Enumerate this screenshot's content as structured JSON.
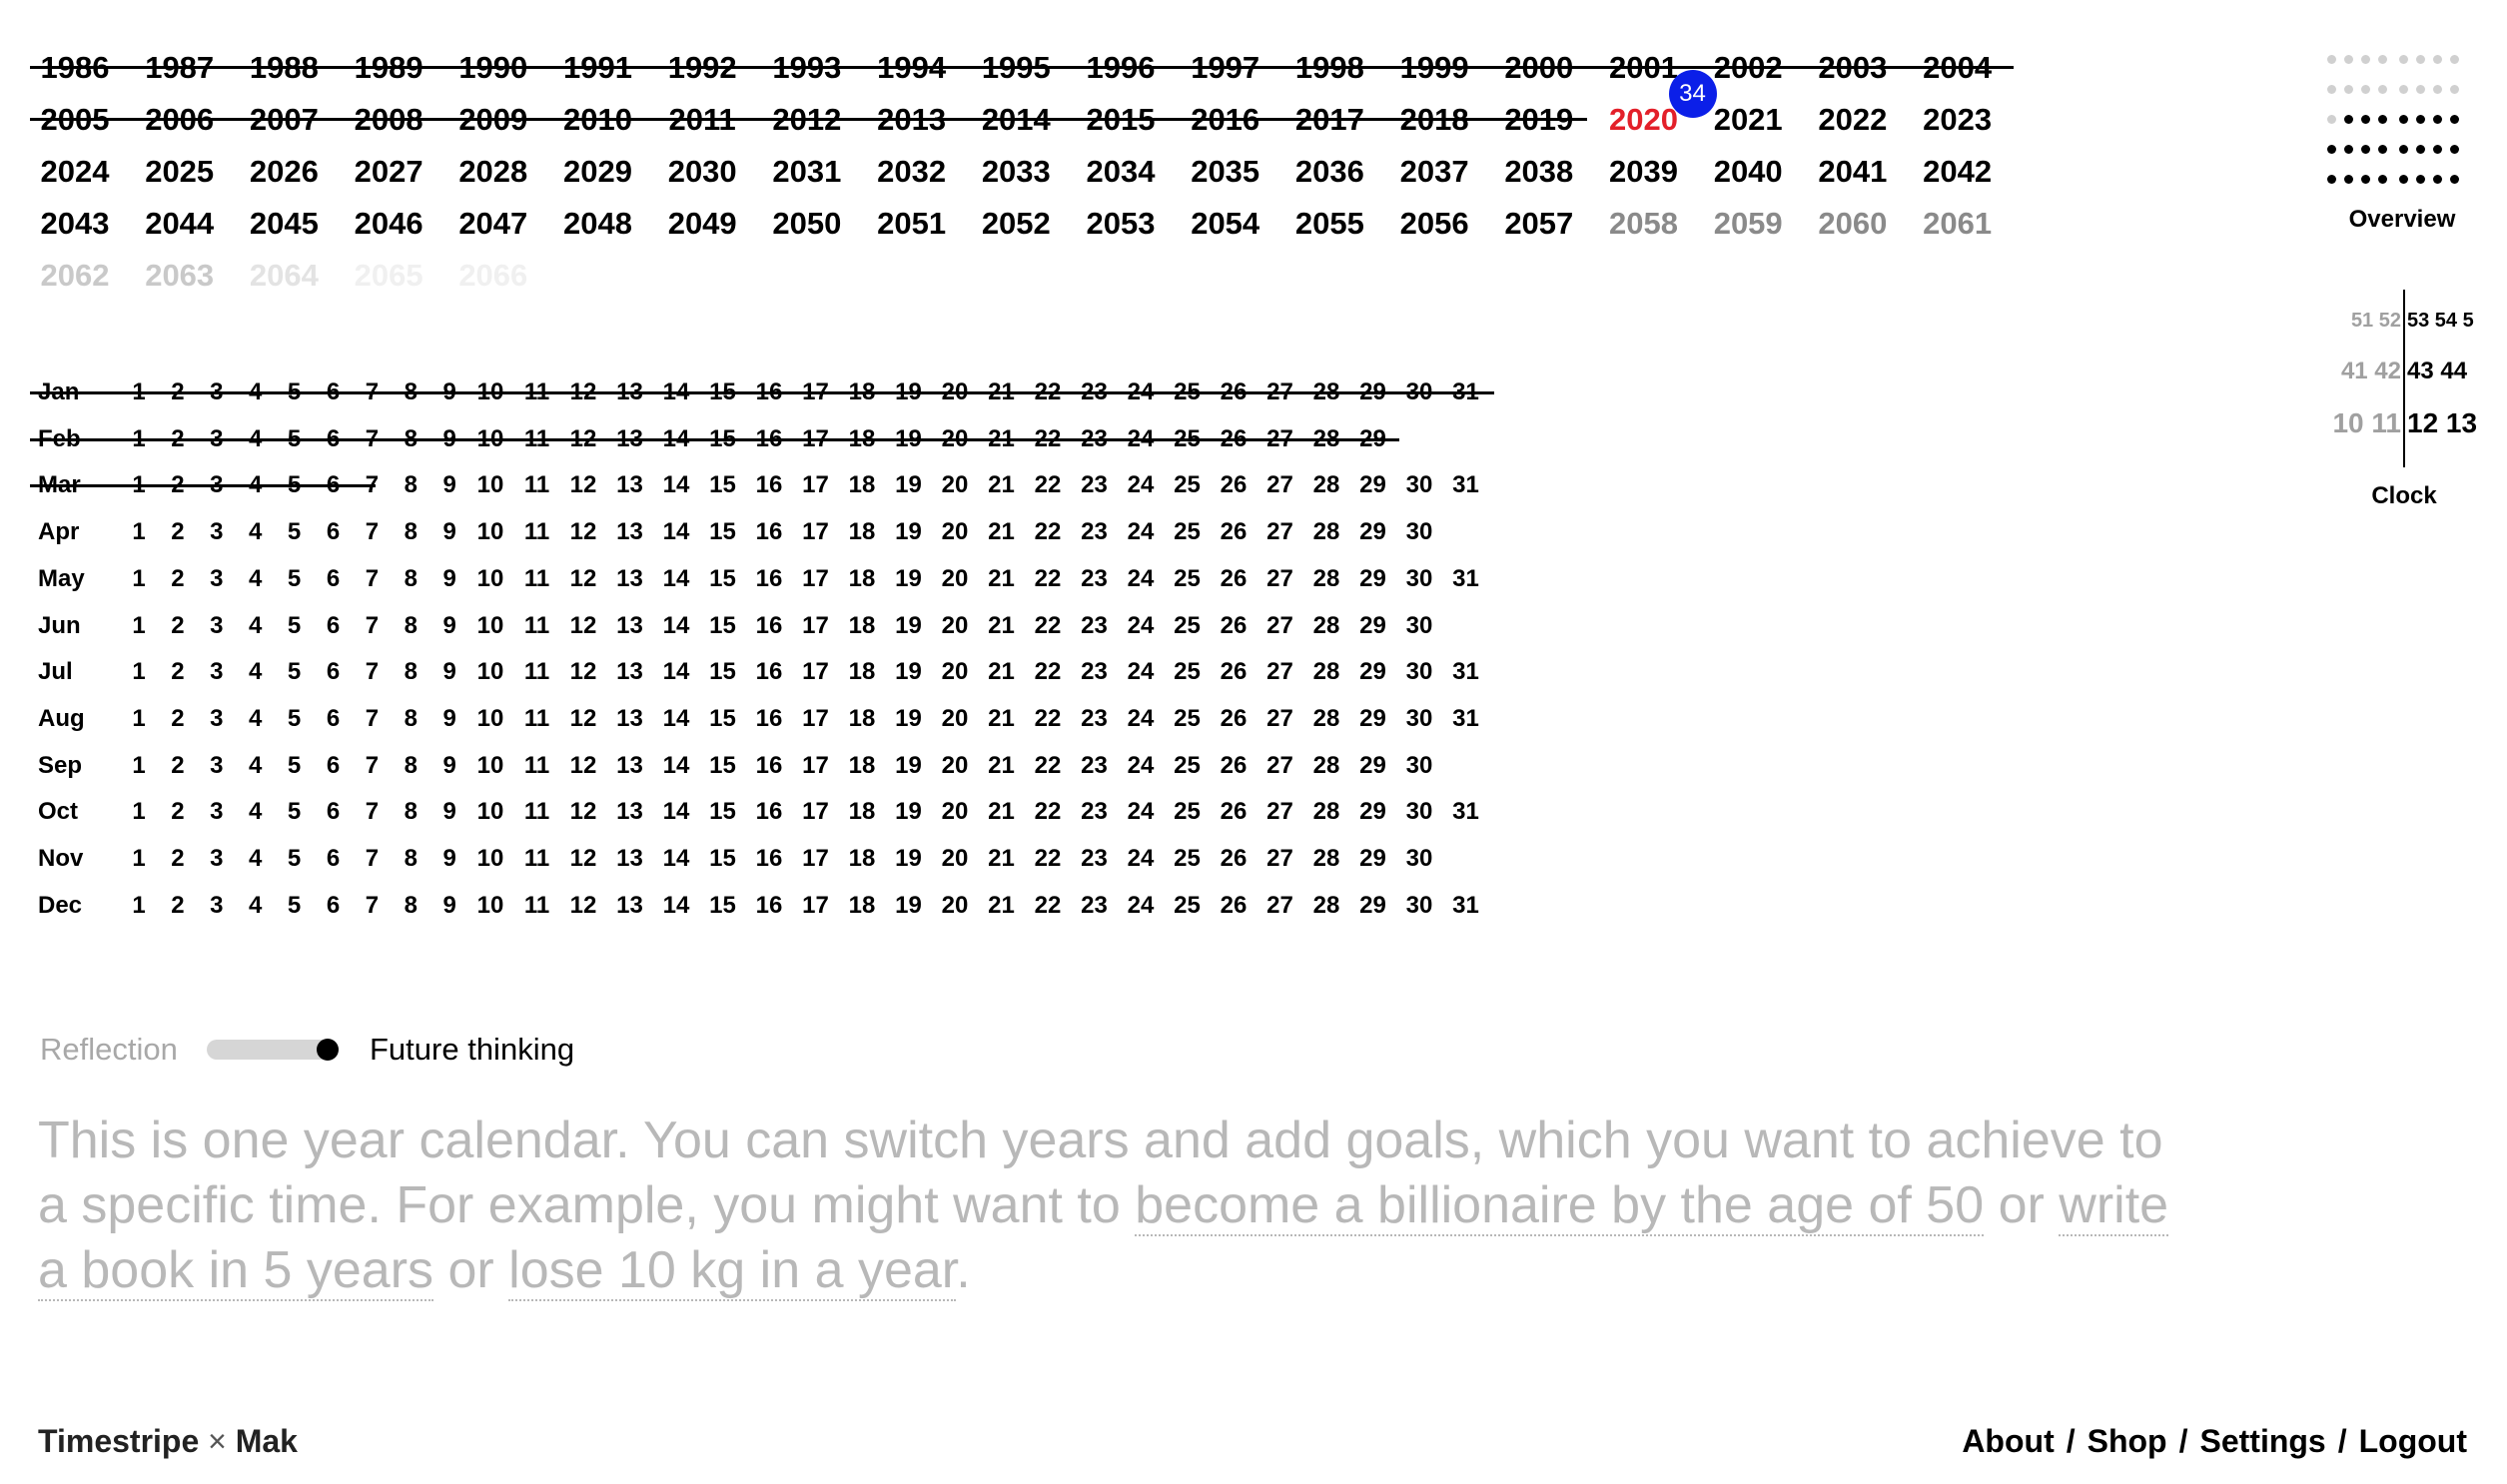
{
  "years": {
    "rows": [
      [
        "1986",
        "1987",
        "1988",
        "1989",
        "1990",
        "1991",
        "1992",
        "1993",
        "1994",
        "1995",
        "1996",
        "1997",
        "1998",
        "1999",
        "2000",
        "2001",
        "2002",
        "2003",
        "2004"
      ],
      [
        "2005",
        "2006",
        "2007",
        "2008",
        "2009",
        "2010",
        "2011",
        "2012",
        "2013",
        "2014",
        "2015",
        "2016",
        "2017",
        "2018",
        "2019",
        "2020",
        "2021",
        "2022",
        "2023"
      ],
      [
        "2024",
        "2025",
        "2026",
        "2027",
        "2028",
        "2029",
        "2030",
        "2031",
        "2032",
        "2033",
        "2034",
        "2035",
        "2036",
        "2037",
        "2038",
        "2039",
        "2040",
        "2041",
        "2042"
      ],
      [
        "2043",
        "2044",
        "2045",
        "2046",
        "2047",
        "2048",
        "2049",
        "2050",
        "2051",
        "2052",
        "2053",
        "2054",
        "2055",
        "2056",
        "2057",
        "2058",
        "2059",
        "2060",
        "2061"
      ],
      [
        "2062",
        "2063",
        "2064",
        "2065",
        "2066"
      ]
    ],
    "current_year": "2020",
    "past_through": "2019",
    "age_badge": "34",
    "accent_current": "#e3202a",
    "badge_color": "#0b1fe8"
  },
  "months": {
    "labels": [
      "Jan",
      "Feb",
      "Mar",
      "Apr",
      "May",
      "Jun",
      "Jul",
      "Aug",
      "Sep",
      "Oct",
      "Nov",
      "Dec"
    ],
    "days_in_month": [
      31,
      29,
      31,
      30,
      31,
      30,
      31,
      31,
      30,
      31,
      30,
      31
    ],
    "current_month_index": 2,
    "current_day": 7
  },
  "toggle": {
    "left_label": "Reflection",
    "right_label": "Future thinking",
    "selected": "Future thinking"
  },
  "description": {
    "intro": "This is one year calendar. You can switch years and add goals, which you want to achieve to a specific time. For example, you might want to ",
    "goal_1": "become a billionaire by the age of 50",
    "or_1": " or ",
    "goal_2": "write a book in 5 years",
    "or_2": " or ",
    "goal_3": "lose 10 kg in a year",
    "end": "."
  },
  "footer": {
    "brand_left": "Timestripe",
    "brand_times": "×",
    "brand_right": "Mak",
    "nav": [
      "About",
      "Shop",
      "Settings",
      "Logout"
    ],
    "separator": "/"
  },
  "sidebar": {
    "overview_label": "Overview",
    "clock_label": "Clock",
    "clock_rows": [
      {
        "dim": "51 52",
        "bright": "53 54 5"
      },
      {
        "dim": "41 42",
        "bright": "43 44"
      },
      {
        "dim": "10 11",
        "bright": "12 13"
      }
    ]
  }
}
